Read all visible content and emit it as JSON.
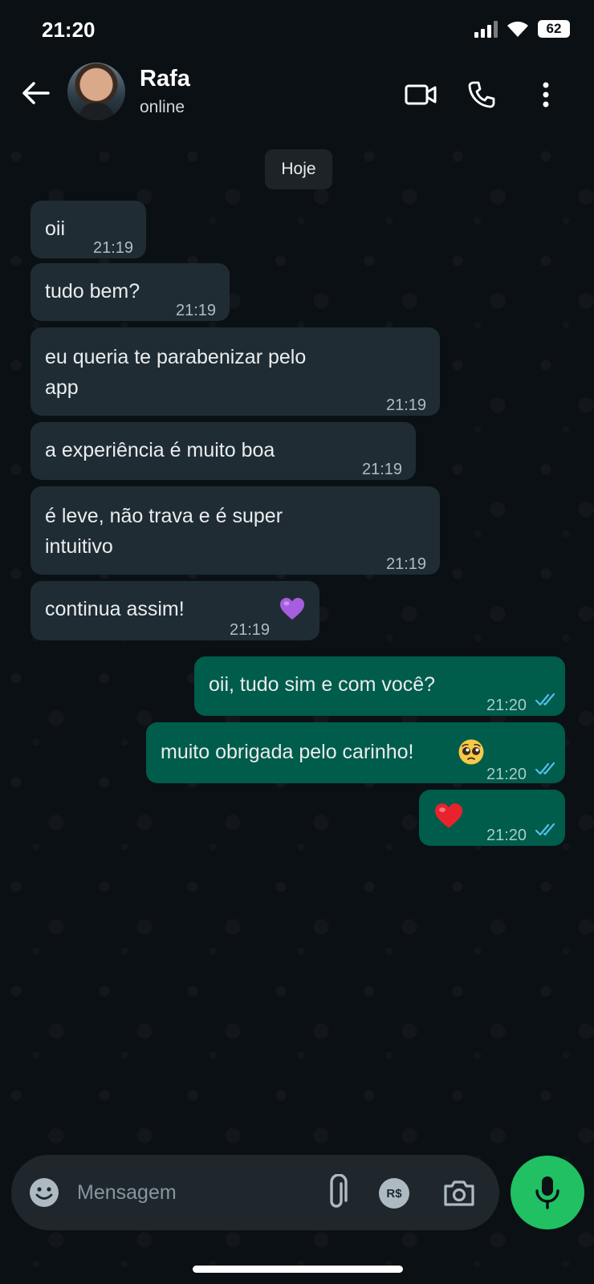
{
  "status_bar": {
    "time": "21:20",
    "battery": "62"
  },
  "header": {
    "name": "Rafa",
    "status": "online"
  },
  "date_separator": "Hoje",
  "messages": [
    {
      "dir": "in",
      "text": "oii",
      "time": "21:19"
    },
    {
      "dir": "in",
      "text": "tudo bem?",
      "time": "21:19"
    },
    {
      "dir": "in",
      "text": "eu queria te parabenizar pelo\napp",
      "time": "21:19"
    },
    {
      "dir": "in",
      "text": "a experiência é muito boa",
      "time": "21:19"
    },
    {
      "dir": "in",
      "text": "é leve, não trava e é super\nintuitivo",
      "time": "21:19"
    },
    {
      "dir": "in",
      "text": "continua assim!",
      "time": "21:19",
      "emoji": "purple-heart"
    },
    {
      "dir": "out",
      "text": "oii, tudo sim e com você?",
      "time": "21:20",
      "read": true
    },
    {
      "dir": "out",
      "text": "muito obrigada pelo carinho!",
      "time": "21:20",
      "read": true,
      "emoji": "pleading-face"
    },
    {
      "dir": "out",
      "text": "",
      "time": "21:20",
      "read": true,
      "emoji": "red-heart"
    }
  ],
  "composer": {
    "placeholder": "Mensagem",
    "pix_label": "R$"
  },
  "colors": {
    "background": "#0b1014",
    "incoming_bubble": "#202c33",
    "outgoing_bubble": "#005c4b",
    "read_ticks": "#53bdeb",
    "mic_button": "#21c063"
  }
}
